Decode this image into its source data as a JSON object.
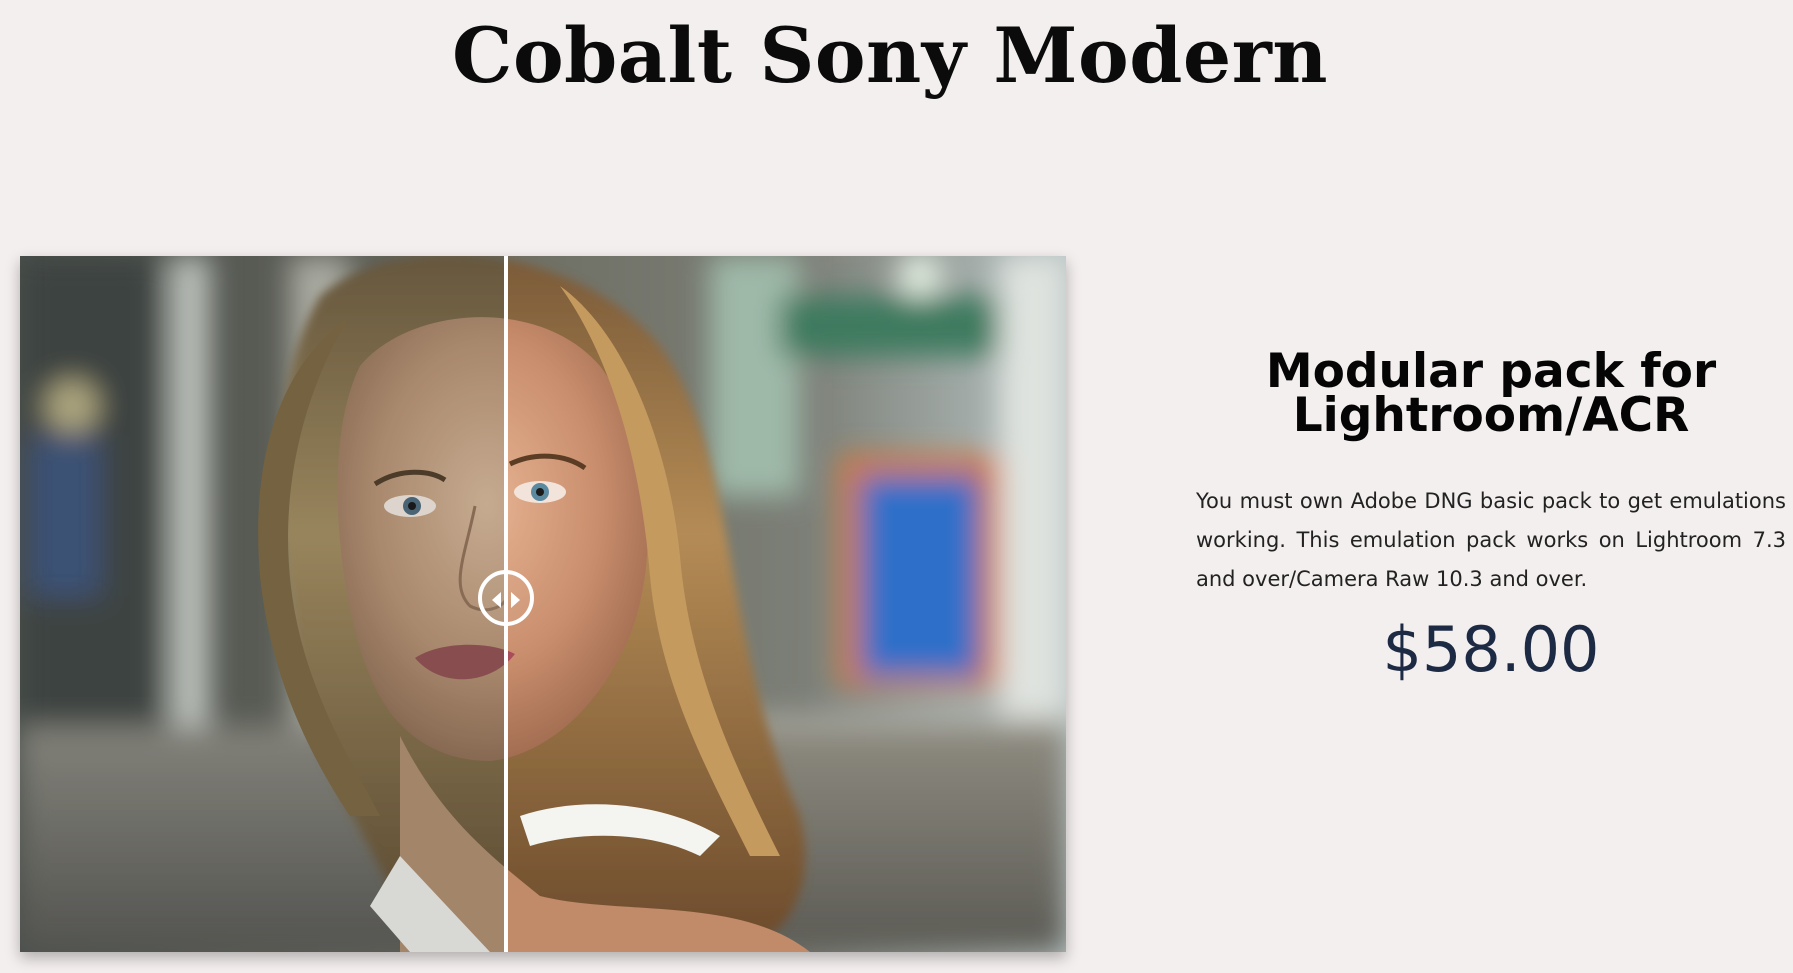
{
  "page": {
    "title": "Cobalt Sony Modern"
  },
  "comparison": {
    "divider_position_fraction": 0.465
  },
  "product": {
    "heading": "Modular pack for Lightroom/ACR",
    "description": "You must own Adobe DNG basic pack to get emulations working. This emulation pack works on Lightroom 7.3 and over/Camera Raw 10.3 and over.",
    "price": "$58.00"
  },
  "colors": {
    "background": "#f4efef",
    "price": "#1d2a44",
    "heading": "#050505",
    "slider": "#ffffff"
  },
  "icons": {
    "handle_left": "arrow-left-icon",
    "handle_right": "arrow-right-icon"
  }
}
